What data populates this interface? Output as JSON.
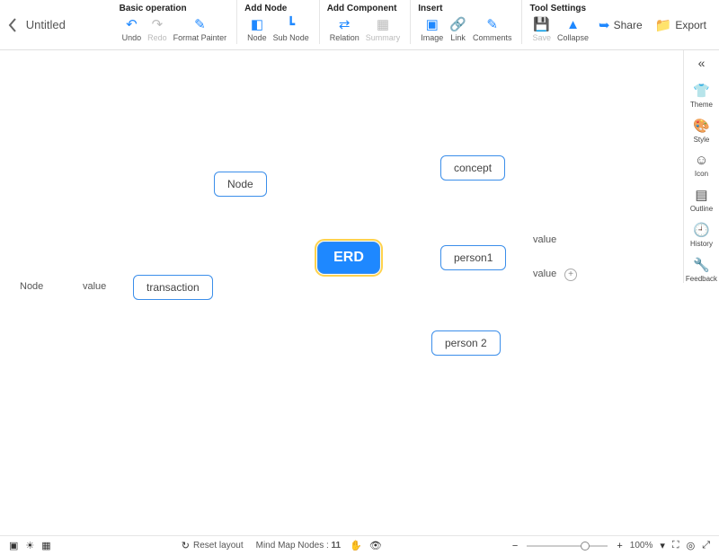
{
  "doc": {
    "title": "Untitled"
  },
  "toolbar": {
    "groups": {
      "basic": {
        "title": "Basic operation",
        "undo": "Undo",
        "redo": "Redo",
        "formatPainter": "Format Painter"
      },
      "addNode": {
        "title": "Add Node",
        "node": "Node",
        "subNode": "Sub Node"
      },
      "addComp": {
        "title": "Add Component",
        "relation": "Relation",
        "summary": "Summary"
      },
      "insert": {
        "title": "Insert",
        "image": "Image",
        "link": "Link",
        "comments": "Comments"
      },
      "toolSet": {
        "title": "Tool Settings",
        "save": "Save",
        "collapse": "Collapse"
      }
    },
    "share": "Share",
    "export": "Export"
  },
  "sidebar": {
    "theme": "Theme",
    "style": "Style",
    "icon": "Icon",
    "outline": "Outline",
    "history": "History",
    "feedback": "Feedback"
  },
  "map": {
    "root": "ERD",
    "node_top": "Node",
    "transaction": "transaction",
    "left_label": "Node",
    "left_value": "value",
    "right": {
      "concept": "concept",
      "person1": "person1",
      "p1_val1": "value",
      "p1_val2": "value",
      "person2": "person 2"
    }
  },
  "status": {
    "reset": "Reset layout",
    "nodes_label": "Mind Map Nodes :",
    "nodes_count": "11",
    "zoom_pct": "100%"
  }
}
